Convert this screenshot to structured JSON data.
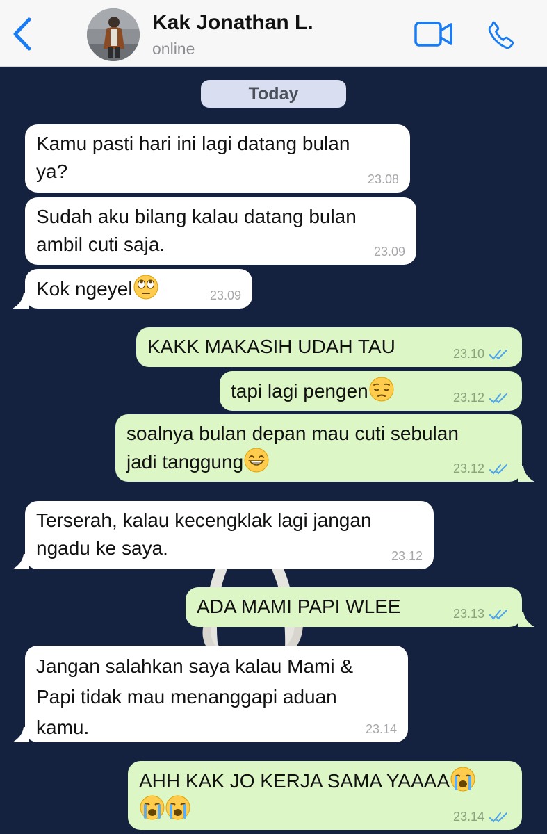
{
  "header": {
    "contact_name": "Kak Jonathan L.",
    "status": "online"
  },
  "chat": {
    "day_label": "Today",
    "messages": [
      {
        "direction": "in",
        "text": "Kamu pasti hari ini lagi datang bulan\nya?",
        "time": "23.08"
      },
      {
        "direction": "in",
        "text": "Sudah aku bilang kalau datang bulan\nambil cuti saja.",
        "time": "23.09"
      },
      {
        "direction": "in",
        "text": "Kok ngeyel",
        "emoji": "face with rolling eyes",
        "time": "23.09"
      },
      {
        "direction": "out",
        "text": "KAKK MAKASIH UDAH TAU",
        "time": "23.10",
        "read": true
      },
      {
        "direction": "out",
        "text": "tapi lagi pengen",
        "emoji": "pensive face",
        "time": "23.12",
        "read": true
      },
      {
        "direction": "out",
        "text": "soalnya bulan depan mau cuti sebulan\njadi tanggung",
        "emoji": "grinning face with smiling eyes",
        "time": "23.12",
        "read": true
      },
      {
        "direction": "in",
        "text": "Terserah, kalau kecengklak lagi jangan\nngadu ke saya.",
        "time": "23.12"
      },
      {
        "direction": "out",
        "text": "ADA MAMI PAPI WLEE",
        "time": "23.13",
        "read": true
      },
      {
        "direction": "in",
        "text": "Jangan salahkan saya kalau Mami &\nPapi tidak mau menanggapi aduan\nkamu.",
        "time": "23.14"
      },
      {
        "direction": "out",
        "text": "AHH KAK JO KERJA SAMA YAAAA",
        "emoji": "loudly crying face x3",
        "time": "23.14",
        "read": true
      }
    ]
  },
  "colors": {
    "accent": "#1a7cf3",
    "chat_background": "#15223f",
    "incoming_bubble": "#ffffff",
    "outgoing_bubble": "#dcf7c5",
    "read_ticks": "#4aa3ee"
  }
}
